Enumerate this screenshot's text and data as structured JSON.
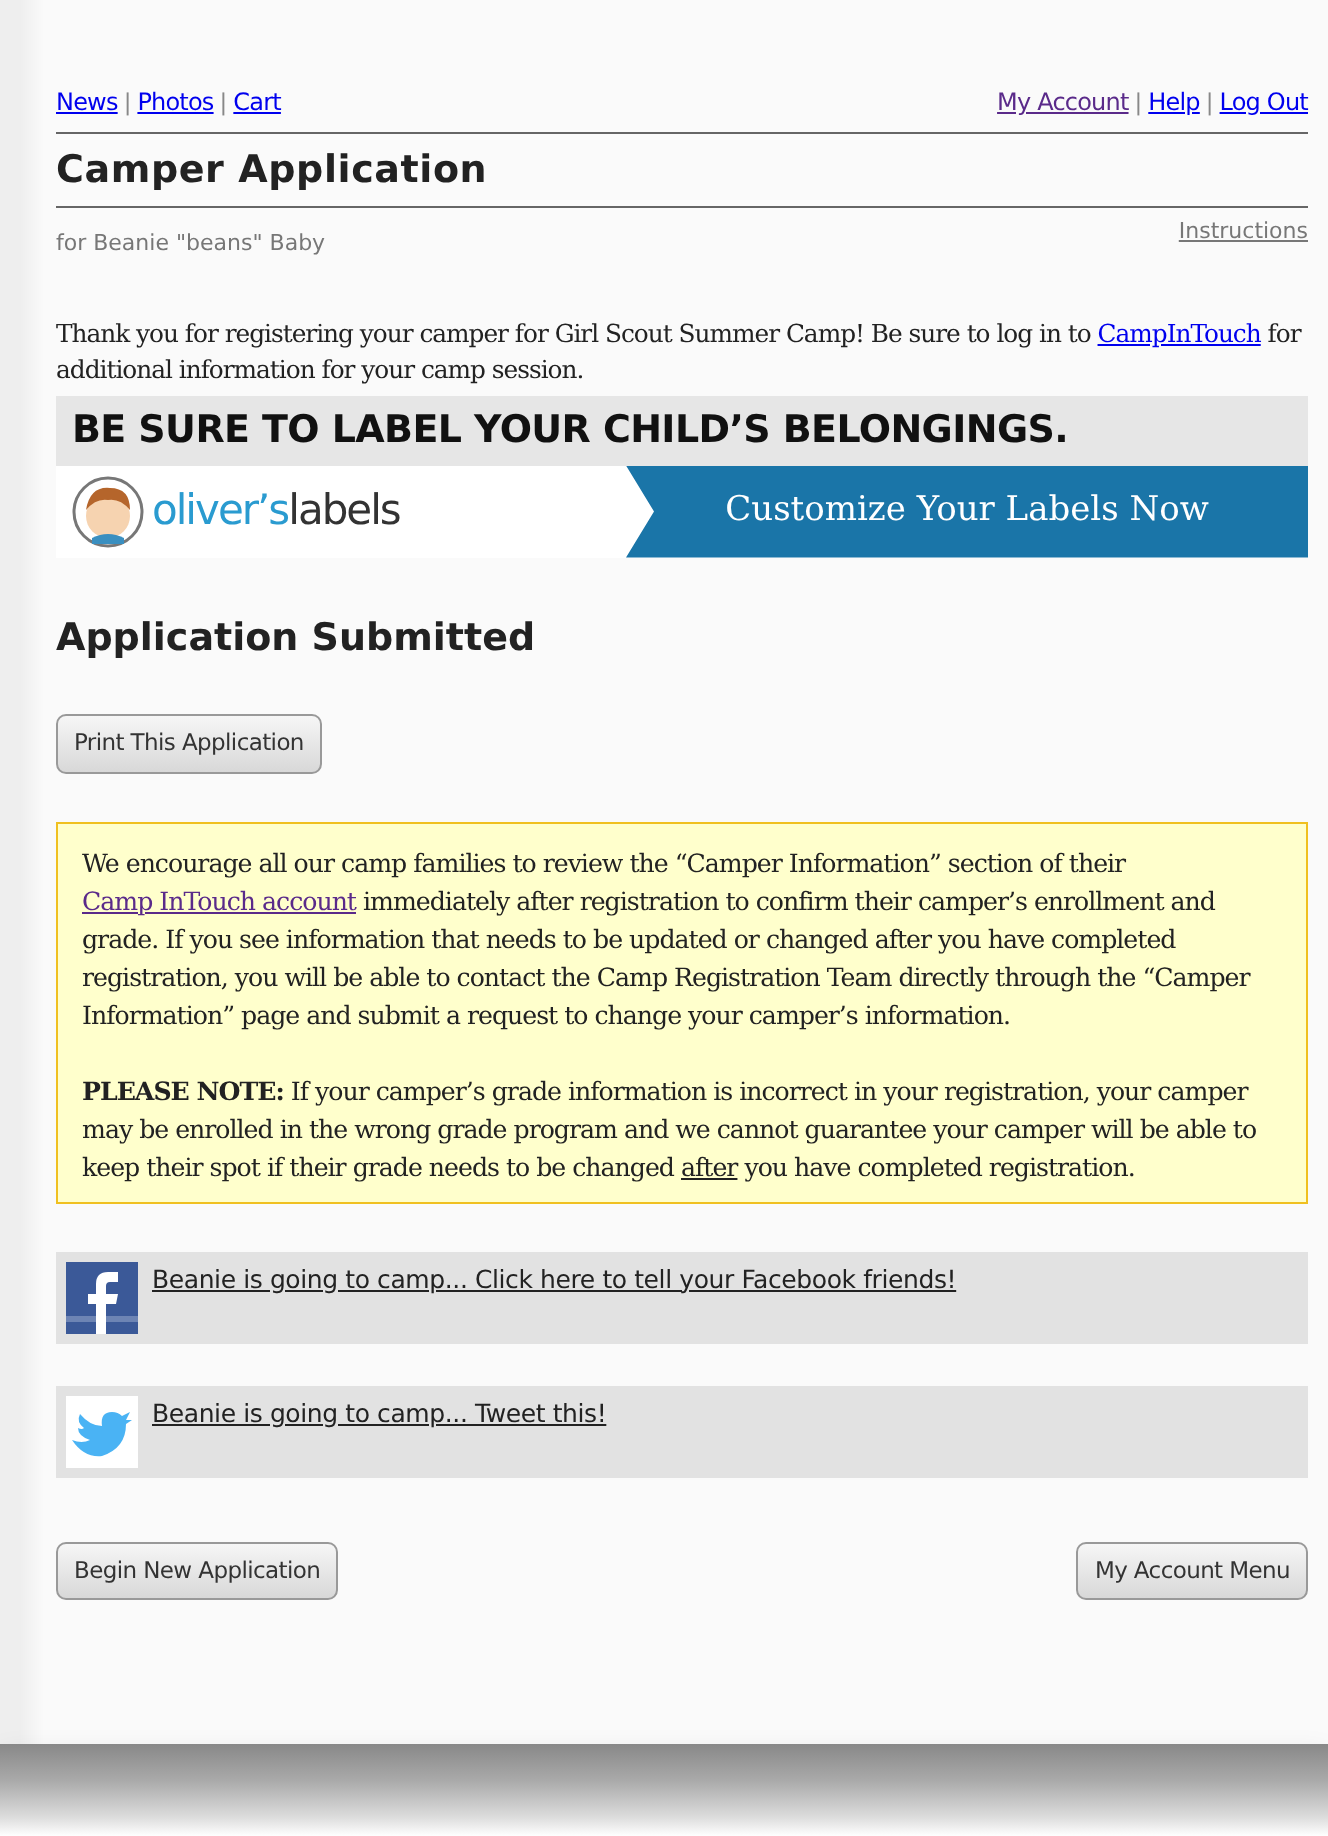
{
  "top_nav": {
    "left_links": [
      {
        "label": "News",
        "visited": false
      },
      {
        "label": "Photos",
        "visited": false
      },
      {
        "label": "Cart",
        "visited": false
      }
    ],
    "right_links": [
      {
        "label": "My Account",
        "visited": true
      },
      {
        "label": "Help",
        "visited": false
      },
      {
        "label": "Log Out",
        "visited": false
      }
    ],
    "separators_left": [
      "|",
      "|"
    ],
    "separators_right": [
      "|",
      "|"
    ]
  },
  "title": "Camper Application",
  "subtitle": "for Beanie \"beans\" Baby",
  "instructions_link": "Instructions",
  "intro": {
    "before": "Thank you for registering your camper for Girl Scout Summer Camp! Be sure to log in to ",
    "link": "CampInTouch",
    "after": " for additional information for your camp session."
  },
  "ad_banner": {
    "headline": "BE SURE TO LABEL YOUR CHILD’S BELONGINGS.",
    "logo_part_1": "oliver’s",
    "logo_part_2": "labels",
    "cta": "Customize Your Labels Now"
  },
  "heading": "Application Submitted",
  "print_button": "Print This Application",
  "notice": {
    "p1_before": "We encourage all our camp families to review the “Camper Information” section of their ",
    "p1_link": "Camp InTouch account",
    "p1_after": " immediately after registration to confirm their camper’s enrollment and grade. If you see information that needs to be updated or changed after you have completed registration, you will be able to contact the Camp Registration Team directly through the “Camper Information” page and submit a request to change your camper’s information.",
    "p2_before": "**PLEASE NOTE:** If your camper’s grade information is incorrect in your registration, your camper may be enrolled in the wrong grade program and we cannot guarantee your camper will be able to keep their spot if their grade needs to be changed ",
    "p2_underlined": "after",
    "p2_after": " you have completed registration."
  },
  "share": [
    {
      "kind": "facebook",
      "label": "Beanie is going to camp... Click here to tell your Facebook friends!"
    },
    {
      "kind": "twitter",
      "label": "Beanie is going to camp... Tweet this!"
    }
  ],
  "buttons": [
    "Begin New Application",
    "My Account Menu"
  ]
}
